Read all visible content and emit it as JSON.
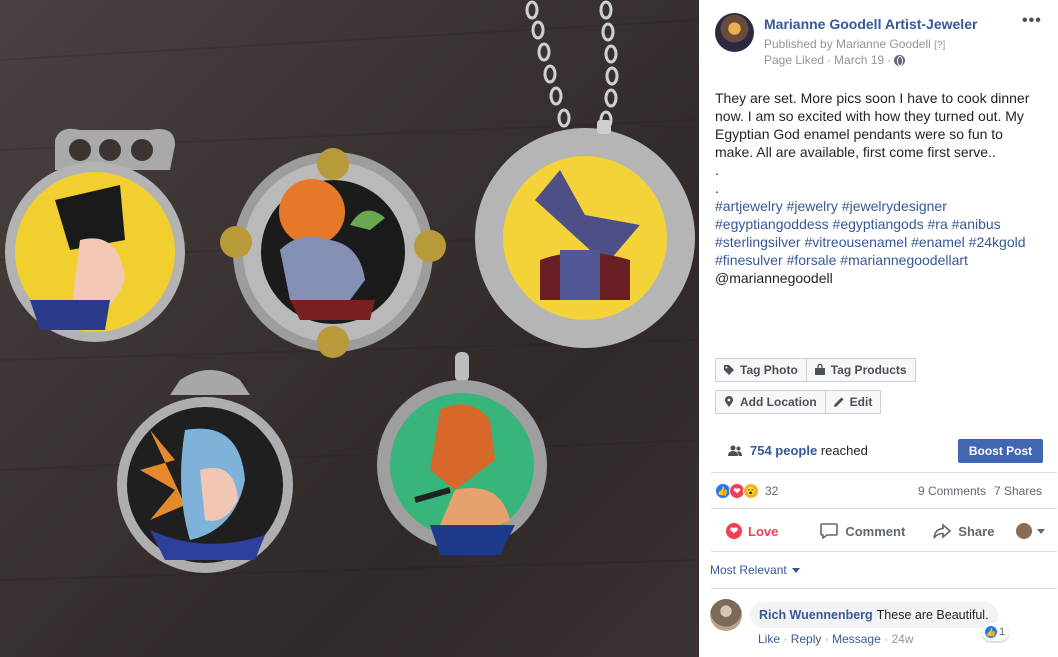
{
  "post": {
    "page_name": "Marianne Goodell Artist-Jeweler",
    "published_by": "Published by Marianne Goodell",
    "published_by_help": "[?]",
    "page_liked": "Page Liked",
    "date": "March 19",
    "separator": "·",
    "more": "•••",
    "text_lines": [
      "They are set. More pics soon I have to cook dinner",
      "now. I am so excited with how they turned out. My",
      "Egyptian God enamel pendants were so fun to",
      "make. All are available, first come first serve..",
      ".",
      "."
    ],
    "hashtag_lines": [
      "#artjewelry #jewelry #jewelrydesigner",
      "#egyptiangoddess #egyptiangods #ra #anibus",
      "#sterlingsilver #vitreousenamel #enamel #24kgold",
      "#finesulver #forsale #mariannegoodellart"
    ],
    "mention": "@mariannegoodell"
  },
  "toolbar": {
    "tag_photo": "Tag Photo",
    "tag_products": "Tag Products",
    "add_location": "Add Location",
    "edit": "Edit"
  },
  "reach": {
    "count_text": "754 people",
    "suffix": "reached",
    "boost_label": "Boost Post"
  },
  "engagement": {
    "reaction_count": "32",
    "comments": "9 Comments",
    "shares": "7 Shares"
  },
  "actions": {
    "love": "Love",
    "comment": "Comment",
    "share": "Share"
  },
  "comments": {
    "sort_label": "Most Relevant",
    "items": [
      {
        "author": "Rich Wuennenberg",
        "text": "These are Beautiful.",
        "like": "Like",
        "reply": "Reply",
        "message": "Message",
        "time": "24w",
        "like_count": "1"
      }
    ]
  },
  "colors": {
    "link_blue": "#365899",
    "boost_blue": "#4267b2",
    "love_red": "#f33e58",
    "like_blue": "#2078f4",
    "wow_yellow": "#f7b125"
  }
}
